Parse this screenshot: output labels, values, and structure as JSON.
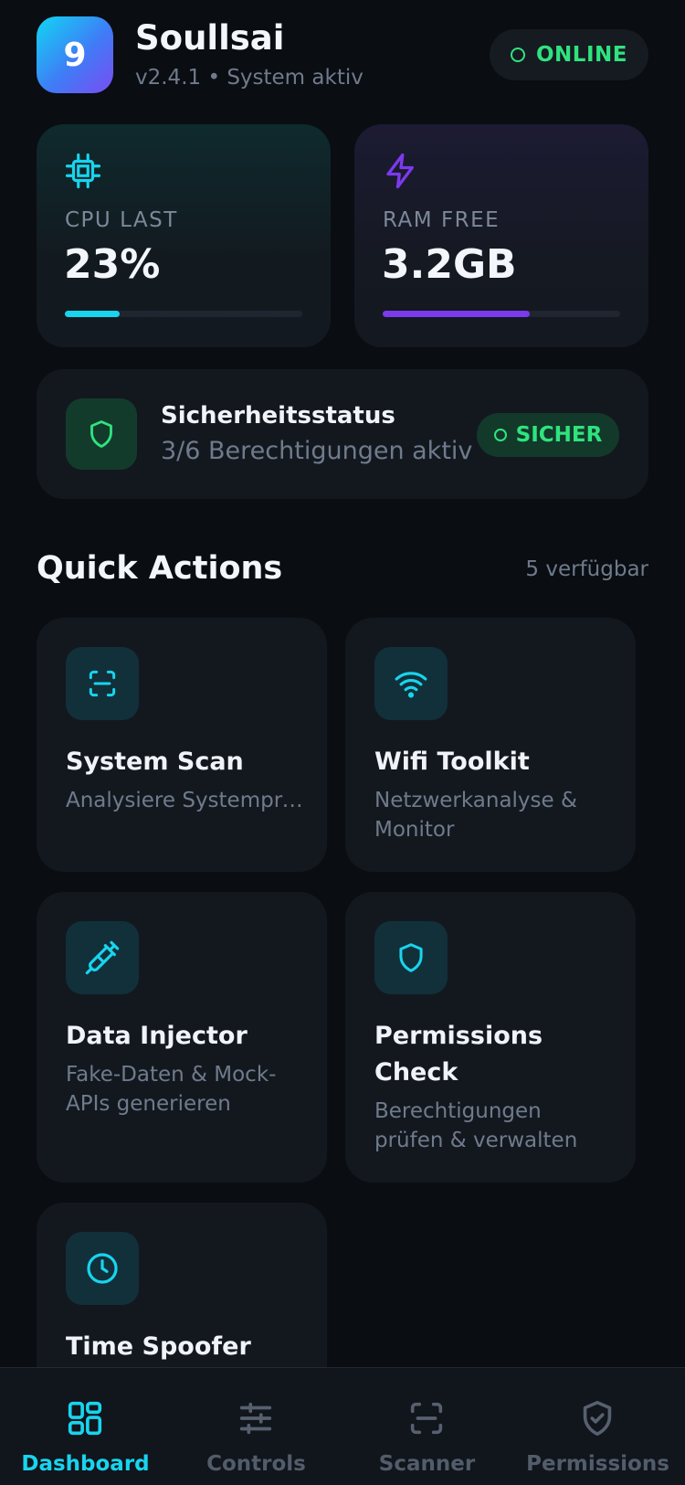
{
  "header": {
    "logo_text": "9",
    "app_name": "Soullsai",
    "subtitle": "v2.4.1 • System aktiv",
    "status": "ONLINE"
  },
  "stats": {
    "cpu": {
      "label": "CPU LAST",
      "value": "23%",
      "fill_percent": 23,
      "icon": "cpu-chip-icon",
      "color": "#18d4ee"
    },
    "ram": {
      "label": "RAM FREE",
      "value": "3.2GB",
      "fill_percent": 62,
      "icon": "lightning-icon",
      "color": "#7c3aed"
    }
  },
  "security": {
    "title": "Sicherheitsstatus",
    "subtitle": "3/6 Berechtigungen aktiv",
    "badge": "SICHER",
    "icon": "shield-icon"
  },
  "quick_actions": {
    "title": "Quick Actions",
    "count_label": "5 verfügbar",
    "items": [
      {
        "name": "System Scan",
        "desc": "Analysiere Systemprozesse und…",
        "icon": "scan-icon"
      },
      {
        "name": "Wifi Toolkit",
        "desc": "Netzwerkanalyse & Monitor",
        "icon": "wifi-icon"
      },
      {
        "name": "Data Injector",
        "desc": "Fake-Daten & Mock-APIs generieren",
        "icon": "syringe-icon"
      },
      {
        "name": "Permissions Check",
        "desc": "Berechtigungen prüfen & verwalten",
        "icon": "shield-icon"
      },
      {
        "name": "Time Spoofer",
        "desc": "",
        "icon": "clock-icon"
      }
    ]
  },
  "nav": {
    "items": [
      {
        "label": "Dashboard",
        "icon": "dashboard-grid-icon",
        "active": true
      },
      {
        "label": "Controls",
        "icon": "sliders-icon",
        "active": false
      },
      {
        "label": "Scanner",
        "icon": "scan-icon",
        "active": false
      },
      {
        "label": "Permissions",
        "icon": "shield-check-icon",
        "active": false
      }
    ]
  },
  "colors": {
    "background": "#0a0d12",
    "card": "#13181f",
    "accent_cyan": "#18d4ee",
    "accent_purple": "#7c3aed",
    "status_green": "#2fe37e",
    "muted_text": "#6f7b8c"
  }
}
